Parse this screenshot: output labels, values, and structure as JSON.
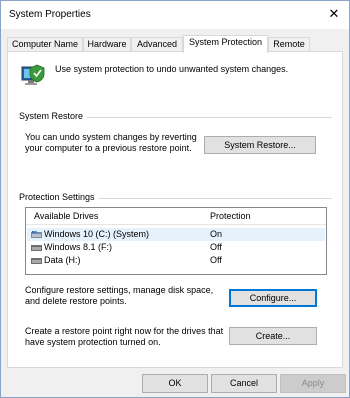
{
  "window": {
    "title": "System Properties",
    "close_glyph": "✕"
  },
  "tabs": [
    {
      "label": "Computer Name",
      "active": false
    },
    {
      "label": "Hardware",
      "active": false
    },
    {
      "label": "Advanced",
      "active": false
    },
    {
      "label": "System Protection",
      "active": true
    },
    {
      "label": "Remote",
      "active": false
    }
  ],
  "intro": {
    "icon": "system-protection-icon",
    "text": "Use system protection to undo unwanted system changes."
  },
  "system_restore": {
    "group_title": "System Restore",
    "description": "You can undo system changes by reverting your computer to a previous restore point.",
    "button_label": "System Restore..."
  },
  "protection_settings": {
    "group_title": "Protection Settings",
    "columns": {
      "drives": "Available Drives",
      "protection": "Protection"
    },
    "drives": [
      {
        "name": "Windows 10 (C:) (System)",
        "protection": "On",
        "icon": "system-drive-icon",
        "selected": true
      },
      {
        "name": "Windows 8.1 (F:)",
        "protection": "Off",
        "icon": "drive-icon",
        "selected": false
      },
      {
        "name": "Data (H:)",
        "protection": "Off",
        "icon": "drive-icon",
        "selected": false
      }
    ],
    "configure_text": "Configure restore settings, manage disk space, and delete restore points.",
    "configure_label": "Configure...",
    "create_text": "Create a restore point right now for the drives that have system protection turned on.",
    "create_label": "Create..."
  },
  "footer": {
    "ok_label": "OK",
    "cancel_label": "Cancel",
    "apply_label": "Apply"
  },
  "colors": {
    "accent": "#0078d7",
    "selection": "#e5f1fb"
  }
}
